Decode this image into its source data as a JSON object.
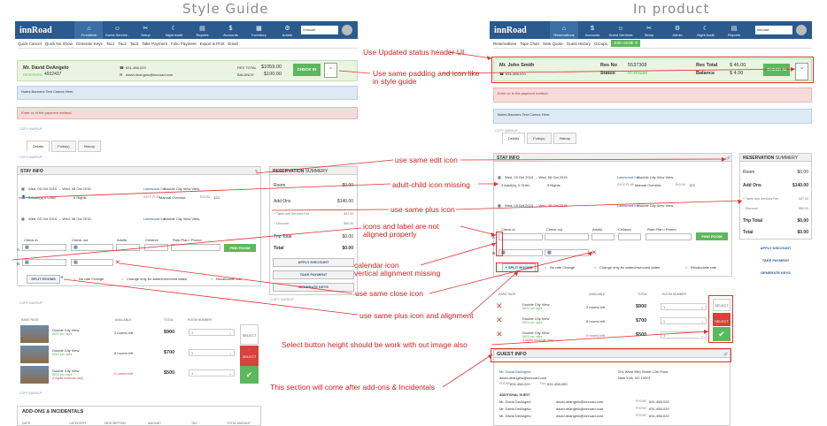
{
  "headings": {
    "left": "Style Guide",
    "right": "In product"
  },
  "left": {
    "nav": {
      "logo": "innRoad",
      "items": [
        {
          "label": "Frontdesk",
          "icon": "⌂",
          "active": true
        },
        {
          "label": "Guest Service..",
          "icon": "☺"
        },
        {
          "label": "Setup",
          "icon": "✂"
        },
        {
          "label": "Night Audit",
          "icon": "☾"
        },
        {
          "label": "Reports",
          "icon": "▤"
        },
        {
          "label": "Accounts",
          "icon": "$"
        },
        {
          "label": "Inventory",
          "icon": "▦"
        },
        {
          "label": "Admin",
          "icon": "⚙"
        }
      ],
      "property": "innroad",
      "user": "AB"
    },
    "toolbar": [
      "Quick Cancel",
      "Quick No Show",
      "Generate Keys",
      "Tac1",
      "Tac2",
      "Tac3",
      "Take Payment",
      "Folio Payment",
      "Export & Print",
      "Email"
    ],
    "guest": {
      "name": "Mr. David DeAngelo",
      "status": "RESERVED",
      "confirmation": "4932437",
      "phone": "631-458-020",
      "email": "david.deangelo@innroad.com",
      "res_total_label": "RES TOTAL",
      "res_total": "$1059.00",
      "balance_label": "BALANCE",
      "balance": "$100.00",
      "checkin": "CHECK IN"
    },
    "banner_notes": "Notes Banners Text Comes Here.",
    "banner_error": "Enter cc in the payment method.",
    "copy_markup": "COPY MARKUP",
    "tabs": [
      "Details",
      "Folio(s)",
      "History"
    ],
    "stay": {
      "title": "STAY INFO",
      "row1": {
        "dates": "Wed, 03 Oct 2015  →  Wed, 08 Oct 2015",
        "guests": "3 Adult(s) 0 Child.",
        "nights": "5 Nights",
        "hotel": "Lakewood Inn",
        "room_type": "Double City View View,",
        "rate_plan_label": "RATE PLAN",
        "rate_plan": "Manual Override",
        "room_label": "ROOM",
        "room": "123"
      },
      "row2": {
        "dates": "Wed, 03 Oct 2015  →  Wed, 08 Oct 2015",
        "hotel": "Lakewood Inn",
        "room_type": "Double City View View,"
      },
      "form_labels": [
        "Check-in",
        "Check out",
        "Adults",
        "Children",
        "Rate Plan / Promo"
      ],
      "find_room": "FIND ROOM",
      "split_rooms": "SPLIT ROOMS",
      "no_rate": "No rate Change",
      "change_only": "Change only for added/removed dates",
      "recalc": "Recalculate rate"
    },
    "summary": {
      "title": "RESERVATION",
      "title2": "SUMMERY",
      "room_label": "Room",
      "room": "$0.00",
      "addons_label": "Add Ons",
      "addons": "$140.00",
      "taxes_label": "Taxes and Services Fee",
      "taxes": "$47.00",
      "discount_label": "Discount",
      "discount": "$50.00",
      "trip_label": "Trip Total",
      "trip": "$0.00",
      "total_label": "Total",
      "total": "$0.00",
      "buttons": [
        "APPLY DISCOUNT",
        "TAKE PAYMENT",
        "GENERATE KEYS"
      ]
    },
    "rates": {
      "headers": [
        "RAKE RATE",
        "AVAILABLE",
        "TOTAL",
        "ROOM NUMBER"
      ],
      "rows": [
        {
          "name": "Double City View",
          "sub": "$500 per night",
          "avail": "2 rooms left",
          "total": "$900",
          "num": "1"
        },
        {
          "name": "Double City View",
          "sub": "$500 per night",
          "avail": "8 rooms left",
          "total": "$700",
          "num": "1"
        },
        {
          "name": "Double City View",
          "sub": "$500 per night",
          "extra": "4 nights minimum stay",
          "avail": "0 rooms left",
          "total": "$500",
          "num": "1"
        }
      ],
      "select": "SELECT"
    },
    "addons": {
      "title": "ADD-ONS & INCIDENTALS",
      "headers": [
        "DATE",
        "CATEGORY",
        "DESCRIPTION",
        "AMOUNT",
        "TAX",
        "TOTAL AMOUNT"
      ]
    }
  },
  "right": {
    "nav": {
      "logo": "innRoad",
      "items": [
        {
          "label": "Reservations",
          "icon": "⌂",
          "active": true
        },
        {
          "label": "Accounts",
          "icon": "$"
        },
        {
          "label": "Guest Services",
          "icon": "☺"
        },
        {
          "label": "Setup",
          "icon": "✂"
        },
        {
          "label": "Admin",
          "icon": "⚙"
        },
        {
          "label": "Night Audit",
          "icon": "☾"
        },
        {
          "label": "Reports",
          "icon": "▤"
        }
      ],
      "property": "innroad",
      "user": "AB"
    },
    "toolbar": [
      "Reservations",
      "Tape Chart",
      "New Quote",
      "Guest History",
      "Groups"
    ],
    "toolbar_chip": "John Smith ✕",
    "guest": {
      "name": "Mr. John Smith",
      "phone": "631-458-020",
      "resno_label": "Res No",
      "resno": "5537308",
      "status_label": "Status",
      "status": "In-House",
      "restotal_label": "Res Total",
      "restotal": "$ 46.00",
      "balance_label": "Balance",
      "balance": "$ 4.00",
      "checkin": "CHECK IN"
    },
    "banner_error": "Enter cc in the payment method.",
    "banner_notes": "Notes Banners Text Comes Here.",
    "copy_markup": "COPY MARKUP",
    "tabs": [
      "Details",
      "Folio(s)",
      "History"
    ],
    "stay": {
      "title": "STAY INFO",
      "row1": {
        "dates": "Wed, 03 Oct 2015  →  Wed, 08 Oct 2015",
        "guests": "3 Adult(s), 0 Child.",
        "nights": "5 Nights",
        "hotel": "Lakewood Inn",
        "room_type": "Double City View View,",
        "rate_plan_label": "RATE PLAN",
        "rate_plan": "Manual Override",
        "room_label": "ROOM",
        "room": "123"
      },
      "row2": {
        "dates": "Wed, 03 Oct 2015  →  Wed, 08 Oct 2015",
        "hotel": "Lakewood Inn",
        "room_type": "Double City View View,"
      },
      "form_labels": [
        "Check-in",
        "Check out",
        "Adults",
        "Children",
        "Rate Plan / Promo"
      ],
      "find_room": "FIND ROOM",
      "split_rooms": "SPLIT ROOMS",
      "no_rate": "No rate Change",
      "change_only": "Change only for added/removed dates",
      "recalc": "Recalculate rate"
    },
    "summary": {
      "title": "RESERVATION",
      "title2": "SUMMERY",
      "room_label": "Room",
      "room": "$0.00",
      "addons_label": "Add Ons",
      "addons": "$140.00",
      "taxes_label": "Taxes and Services Fee",
      "taxes": "$47.00",
      "discount_label": "Discount",
      "discount": "$50.00",
      "trip_label": "Trip Total",
      "trip": "$0.00",
      "total_label": "Total",
      "total": "$0.00",
      "buttons": [
        "APPLY DISCOUNT",
        "TAKE PAYMENT",
        "GENERATE KEYS"
      ]
    },
    "rates": {
      "headers": [
        "RAKE RATE",
        "AVAILABLE",
        "TOTAL",
        "ROOM NUMBER"
      ],
      "rows": [
        {
          "name": "Double City View",
          "sub": "$500 per night",
          "avail": "2 rooms left",
          "total": "$900",
          "num": "1"
        },
        {
          "name": "Double City View",
          "sub": "$500 per night",
          "avail": "8 rooms left",
          "total": "$700",
          "num": "1"
        },
        {
          "name": "Double City View",
          "sub": "$500 per night",
          "extra": "4 nights minimum stay",
          "avail": "0 rooms left",
          "total": "$500",
          "num": "1"
        }
      ],
      "select": "SELECT"
    },
    "guest_info": {
      "title": "GUEST INFO",
      "name": "Mr. David DeAngelo",
      "email": "david.deangelo@innroad.com",
      "phone_label": "PHONE",
      "phone": "631-458-020",
      "fax_label": "FAX",
      "fax": "631-458-060",
      "address": "2n1 West 99th Street 12th Floor",
      "city": "New York, NY 10001",
      "additional_label": "ADDITIONAL GUEST",
      "additional": [
        {
          "name": "Mr. David DeAngelo",
          "email": "david.deangelo@innroad.com",
          "phone_label": "PHONE",
          "phone": "631-458-020"
        },
        {
          "name": "Mr. David DeAngelo",
          "email": "david.deangelo@innroad.com",
          "phone_label": "PHONE",
          "phone": "631-458-020"
        },
        {
          "name": "Mr. David DeAngelo",
          "email": "david.deangelo@innroad.com",
          "phone_label": "PHONE",
          "phone": "631-458-020"
        }
      ]
    }
  },
  "annotations": [
    "Use Updated status header UI",
    "Use same padding and icon like",
    "in style guide",
    "use same edit icon",
    "adult-child icon missing",
    "use same plus icon",
    "icons and label are not",
    "aligned properly",
    "calendar icon",
    "vertical alignment missing",
    "use same close icon",
    "use same plus icon and alignment",
    "Select button height should be work with out image also",
    "This section will come after add-ons & Incidentals"
  ],
  "colors": {
    "nav": "#2a5a8e",
    "accent_green": "#5cb85c",
    "annotation": "#d42020",
    "error": "#d9413a"
  }
}
